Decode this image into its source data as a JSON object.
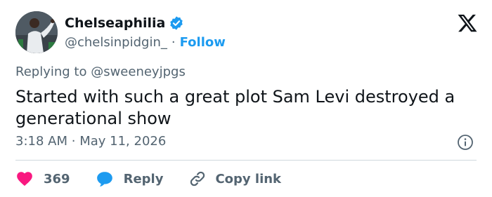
{
  "user": {
    "display_name": "Chelseaphilia",
    "handle": "@chelsinpidgin_",
    "separator": "·",
    "follow_label": "Follow"
  },
  "tweet": {
    "replying_prefix": "Replying to ",
    "replying_to": "@sweeneyjpgs",
    "text": "Started with such a great plot Sam Levi destroyed a generational show",
    "time": "3:18 AM",
    "separator": "·",
    "date": "May 11, 2026"
  },
  "actions": {
    "like_count": "369",
    "reply_label": "Reply",
    "copy_label": "Copy link"
  },
  "icons": {
    "verified": "verified-badge-icon",
    "logo": "x-logo-icon",
    "info": "info-icon",
    "like": "heart-icon",
    "reply": "speech-bubble-icon",
    "copy": "link-icon"
  },
  "colors": {
    "accent": "#1d9bf0",
    "like": "#f91880",
    "muted": "#536471",
    "text": "#0f1419"
  }
}
